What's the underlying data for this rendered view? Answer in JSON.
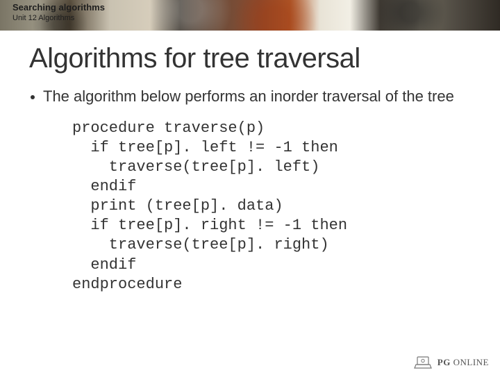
{
  "banner": {
    "title": "Searching algorithms",
    "subtitle": "Unit 12 Algorithms"
  },
  "slide": {
    "heading": "Algorithms for tree traversal",
    "bullet": "The algorithm below performs an inorder traversal of the tree"
  },
  "code_lines": [
    "procedure traverse(p)",
    "  if tree[p]. left != -1 then",
    "    traverse(tree[p]. left)",
    "  endif",
    "  print (tree[p]. data)",
    "  if tree[p]. right != -1 then",
    "    traverse(tree[p]. right)",
    "  endif",
    "endprocedure"
  ],
  "footer": {
    "brand_bold": "PG",
    "brand_rest": " ONLINE"
  }
}
